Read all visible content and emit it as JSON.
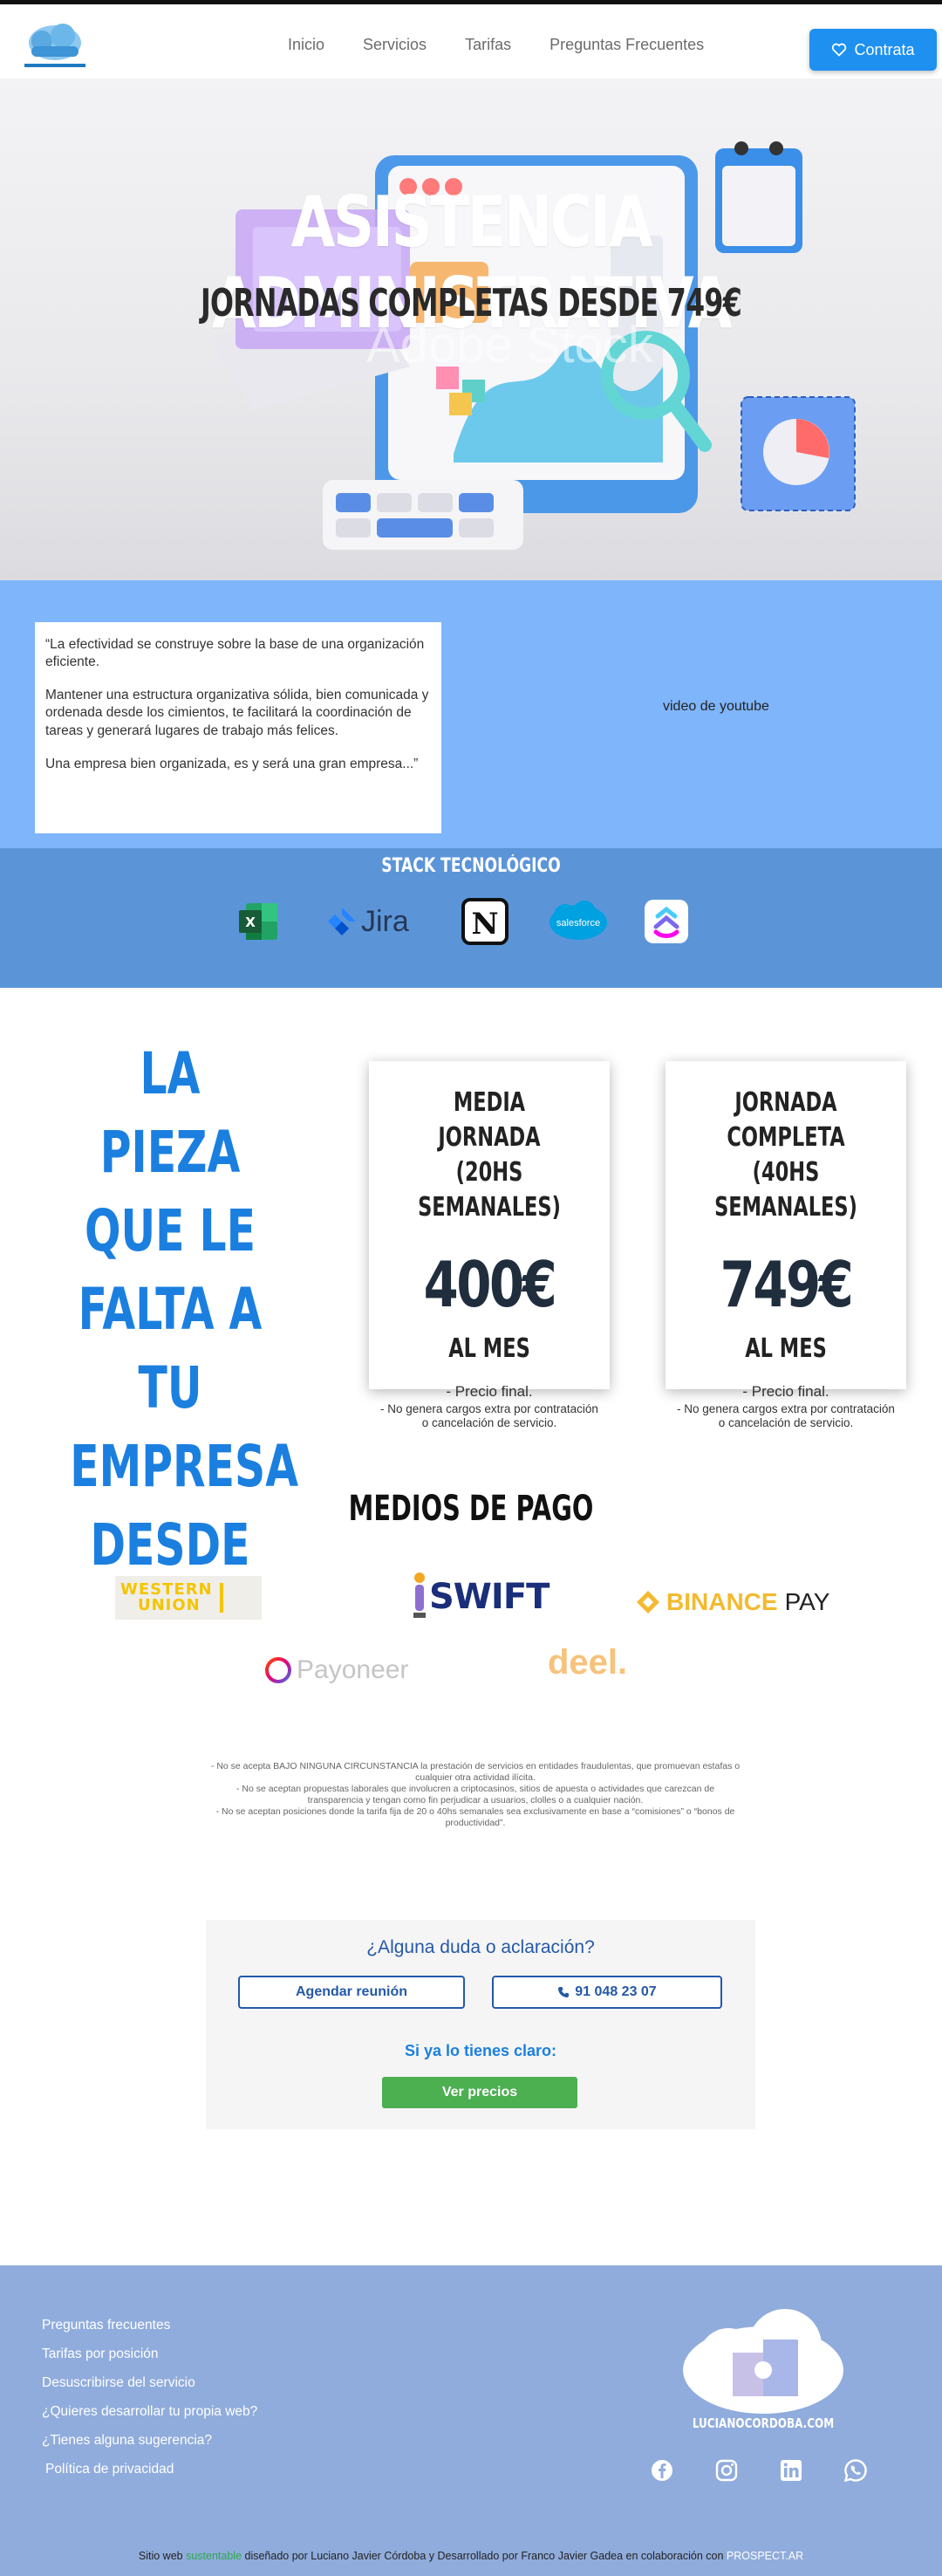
{
  "header": {
    "nav": [
      "Inicio",
      "Servicios",
      "Tarifas",
      "Preguntas Frecuentes"
    ],
    "cta_label": "Contrata",
    "cta_icon": "heart-icon",
    "logo_caption": "LUCIANOCORDOBA.COM"
  },
  "hero": {
    "title": "ASISTENCIA ADMINISTRATIVA",
    "subtitle": "JORNADAS COMPLETAS DESDE 749€",
    "watermark": "Adobe Stock"
  },
  "quote": {
    "p1": "“La efectividad se construye sobre la base de una organización eficiente.",
    "p2": "Mantener una estructura organizativa sólida, bien comunicada y ordenada desde los cimientos, te facilitará la coordinación de tareas y generará lugares de trabajo más felices.",
    "p3": "Una empresa bien organizada, es y será una gran empresa...”",
    "video_label": "video de youtube"
  },
  "stack": {
    "title": "STACK TECNOLÓGICO",
    "jira_label": "Jira",
    "notion_label": "N",
    "salesforce_label": "salesforce",
    "excel_label": "X"
  },
  "pricing": {
    "lead": [
      "LA PIEZA",
      "QUE LE",
      "FALTA A TU",
      "EMPRESA",
      "DESDE"
    ],
    "cards": [
      {
        "title_line1": "MEDIA JORNADA",
        "title_line2": "(20HS SEMANALES)",
        "price": "400€",
        "period": "AL MES",
        "final": "-   Precio final.",
        "note": "-   No genera cargos extra por contratación o cancelación de servicio."
      },
      {
        "title_line1": "JORNADA COMPLETA",
        "title_line2": "(40HS SEMANALES)",
        "price": "749€",
        "period": "AL MES",
        "final": "-   Precio final.",
        "note": "-   No genera cargos extra por contratación o cancelación de servicio."
      }
    ]
  },
  "payment": {
    "title": "MEDIOS DE PAGO",
    "western_union": "WESTERN\nUNION",
    "western_line1": "WESTERN",
    "western_line2": "UNION",
    "swift": "SWIFT",
    "binance": "BINANCE",
    "binance_pay": "PAY",
    "payoneer": "Payoneer",
    "deel": "deel."
  },
  "legal": {
    "l1": "- No se acepta BAJO NINGUNA CIRCUNSTANCIA la prestación de servicios en entidades fraudulentas, que promuevan estafas o cualquier otra actividad ilícita.",
    "l2": "- No se aceptan propuestas laborales que involucren a criptocasinos, sitios de apuesta o actividades que carezcan de transparencia y tengan como fin perjudicar a usuarios, clolles o a cualquier nación.",
    "l3": "- No se aceptan posiciones donde la tarifa fija de 20 o 40hs semanales sea exclusivamente en base a “comisiones” o “bonos de productividad”."
  },
  "contact": {
    "title": "¿Alguna duda o aclaración?",
    "meeting_label": "Agendar reunión",
    "phone_label": "91 048 23 07",
    "sub": "Si ya lo tienes claro:",
    "prices_label": "Ver precios"
  },
  "footer": {
    "links": [
      "Preguntas frecuentes",
      "Tarifas por posición",
      "Desuscribirse del servicio",
      "¿Quieres desarrollar tu propia web?",
      "¿Tienes alguna sugerencia?",
      "Política de privacidad"
    ],
    "brand": "LUCIANOCORDOBA.COM",
    "credit_a": "Sitio web ",
    "credit_green": "sustentable",
    "credit_b": " diseñado por Luciano Javier Córdoba y Desarrollado por Franco Javier Gadea en colaboración con ",
    "credit_white": "PROSPECT.AR",
    "socials": [
      "facebook-icon",
      "instagram-icon",
      "linkedin-icon",
      "whatsapp-icon"
    ]
  },
  "colors": {
    "accent": "#1e90f0",
    "quote_bg": "#7fb5fb",
    "stack_bg": "#5b95d8",
    "lead_blue": "#1b7fe0",
    "footer_bg": "#90acdc",
    "green": "#4caf50"
  }
}
